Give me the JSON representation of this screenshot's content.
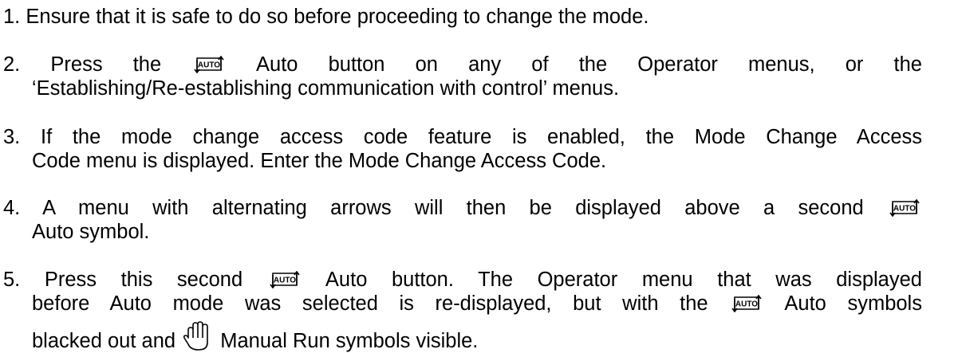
{
  "items": [
    {
      "number": "1.",
      "text": "Ensure that it is safe to do so before proceeding to change the mode."
    },
    {
      "number": "2.",
      "part1": "Press the",
      "part2": "Auto button on any of the Operator menus, or the",
      "line2": "‘Establishing/Re-establishing communication with control’ menus."
    },
    {
      "number": "3.",
      "line1": "If the mode change access code feature is enabled, the Mode Change Access",
      "line2": "Code menu is displayed. Enter the Mode Change Access Code."
    },
    {
      "number": "4.",
      "line1": "A menu with alternating arrows will then be displayed above a second",
      "line2": "Auto symbol."
    },
    {
      "number": "5.",
      "part1": "Press this second",
      "part2": "Auto button. The Operator menu that was displayed",
      "line2a": "before Auto mode was selected is re-displayed, but with the",
      "line2b": "Auto symbols",
      "line3a": "blacked out and",
      "line3b": "Manual Run symbols visible."
    }
  ],
  "icons": {
    "auto": "auto-mode-icon",
    "manual": "manual-run-hand-icon"
  }
}
